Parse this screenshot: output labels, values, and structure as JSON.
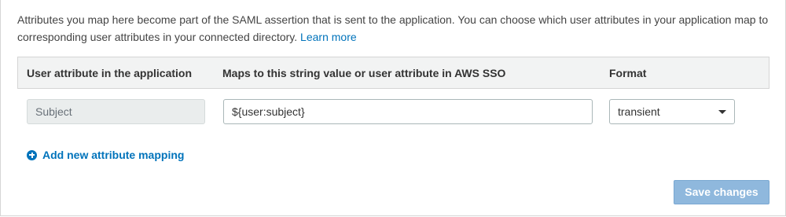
{
  "description": {
    "text": "Attributes you map here become part of the SAML assertion that is sent to the application. You can choose which user attributes in your application map to corresponding user attributes in your connected directory.",
    "learn_more": "Learn more"
  },
  "table": {
    "headers": {
      "app_attribute": "User attribute in the application",
      "maps_to": "Maps to this string value or user attribute in AWS SSO",
      "format": "Format"
    },
    "rows": [
      {
        "app_attribute": "Subject",
        "maps_to": "${user:subject}",
        "format": "transient"
      }
    ]
  },
  "add_mapping_label": "Add new attribute mapping",
  "save_label": "Save changes",
  "colors": {
    "link": "#0073bb",
    "header_bg": "#f2f3f3",
    "save_disabled": "#8fb8dd"
  },
  "icons": {
    "add": "plus-circle-icon",
    "dropdown": "caret-down-icon"
  }
}
